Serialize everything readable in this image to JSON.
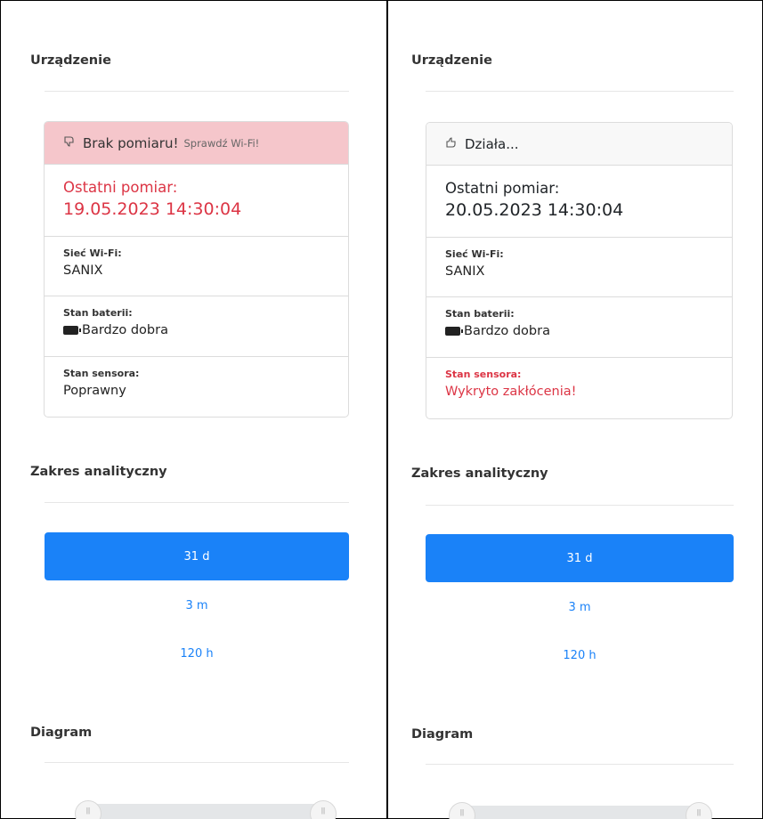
{
  "panels": [
    {
      "device_section_title": "Urządzenie",
      "status": {
        "icon": "thumbs-down-icon",
        "text": "Brak pomiaru!",
        "hint": "Sprawdź Wi-Fi!",
        "state": "alert"
      },
      "last_measurement": {
        "label": "Ostatni pomiar:",
        "value": "19.05.2023 14:30:04",
        "danger": true
      },
      "wifi": {
        "label": "Sieć Wi-Fi:",
        "value": "SANIX"
      },
      "battery": {
        "label": "Stan baterii:",
        "icon": "battery-full-icon",
        "value": "Bardzo dobra"
      },
      "sensor": {
        "label": "Stan sensora:",
        "value": "Poprawny",
        "danger": false
      },
      "range_section_title": "Zakres analityczny",
      "range_options": [
        {
          "label": "31 d",
          "active": true
        },
        {
          "label": "3 m",
          "active": false
        },
        {
          "label": "120 h",
          "active": false
        }
      ],
      "diagram_section_title": "Diagram"
    },
    {
      "device_section_title": "Urządzenie",
      "status": {
        "icon": "thumbs-up-icon",
        "text": "Działa...",
        "hint": "",
        "state": "ok"
      },
      "last_measurement": {
        "label": "Ostatni pomiar:",
        "value": "20.05.2023 14:30:04",
        "danger": false
      },
      "wifi": {
        "label": "Sieć Wi-Fi:",
        "value": "SANIX"
      },
      "battery": {
        "label": "Stan baterii:",
        "icon": "battery-full-icon",
        "value": "Bardzo dobra"
      },
      "sensor": {
        "label": "Stan sensora:",
        "value": "Wykryto zakłócenia!",
        "danger": true
      },
      "range_section_title": "Zakres analityczny",
      "range_options": [
        {
          "label": "31 d",
          "active": true
        },
        {
          "label": "3 m",
          "active": false
        },
        {
          "label": "120 h",
          "active": false
        }
      ],
      "diagram_section_title": "Diagram"
    }
  ],
  "colors": {
    "primary": "#1a82f8",
    "danger": "#dc3545",
    "alert_bg": "#f5c6cb"
  }
}
